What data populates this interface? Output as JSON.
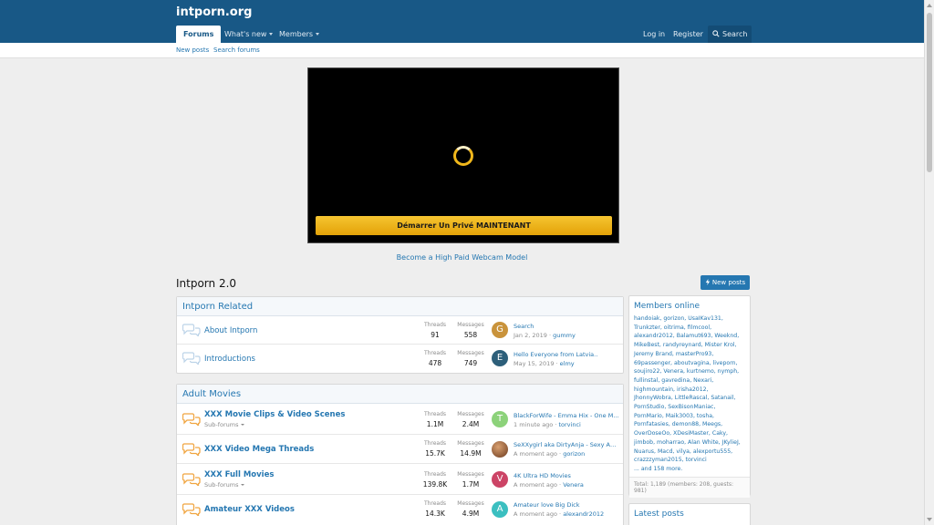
{
  "header": {
    "logo": "intporn.org",
    "tabs": [
      {
        "label": "Forums"
      },
      {
        "label": "What's new"
      },
      {
        "label": "Members"
      }
    ],
    "login": "Log in",
    "register": "Register",
    "search": "Search"
  },
  "subnav": {
    "new_posts": "New posts",
    "search_forums": "Search forums"
  },
  "ad": {
    "cta": "Démarrer Un Privé MAINTENANT",
    "link": "Become a High Paid Webcam Model"
  },
  "page": {
    "title": "Intporn 2.0",
    "new_posts_btn": "New posts"
  },
  "labels": {
    "threads": "Threads",
    "messages": "Messages",
    "subforums": "Sub-forums"
  },
  "categories": [
    {
      "title": "Intporn Related",
      "nodes": [
        {
          "title": "About Intporn",
          "threads": "91",
          "messages": "558",
          "avatar_letter": "G",
          "avatar_color": "#c9933b",
          "last_title": "Search",
          "last_date": "Jan 2, 2019",
          "last_user": "gummy"
        },
        {
          "title": "Introductions",
          "threads": "478",
          "messages": "749",
          "avatar_letter": "E",
          "avatar_color": "#2d5f7a",
          "last_title": "Hello Everyone from Latvia..",
          "last_date": "May 15, 2019",
          "last_user": "elmy"
        }
      ]
    },
    {
      "title": "Adult Movies",
      "nodes": [
        {
          "title": "XXX Movie Clips & Video Scenes",
          "subforums": true,
          "threads": "1.1M",
          "messages": "2.4M",
          "avatar_letter": "T",
          "avatar_color": "#8cd27a",
          "last_title": "BlackForWife - Emma Hix - One M...",
          "last_date": "1 minute ago",
          "last_user": "torvinci"
        },
        {
          "title": "XXX Video Mega Threads",
          "subforums": false,
          "threads": "15.7K",
          "messages": "14.9M",
          "avatar_letter": "",
          "avatar_color": "#7a4a2a",
          "last_title": "SeXXygirl aka DirtyAnja - Sexy Ama...",
          "last_date": "A moment ago",
          "last_user": "gorizon"
        },
        {
          "title": "XXX Full Movies",
          "subforums": true,
          "threads": "139.8K",
          "messages": "1.7M",
          "avatar_letter": "V",
          "avatar_color": "#cc4466",
          "last_title": "4K Ultra HD Movies",
          "last_date": "A moment ago",
          "last_user": "Venera"
        },
        {
          "title": "Amateur XXX Videos",
          "subforums": false,
          "threads": "14.3K",
          "messages": "4.9M",
          "avatar_letter": "A",
          "avatar_color": "#3bbfc0",
          "last_title": "Amateur love Big Dick",
          "last_date": "A moment ago",
          "last_user": "alexandr2012"
        }
      ]
    }
  ],
  "sidebar": {
    "members_online_title": "Members online",
    "members_text": "handoiak, gorizon, UsaIKav131, Trunkzter, oitrima, filmcool, alexandr2012, Balamut693, Weeknd, MikeBest, randyreynard, Mister Krol, Jeremy Brand, masterPro93, 69passenger, aboutvagina, liveporn, soujiro22, Venera, kurtnemo, nymph, fullinstal, gavredina, Nexari, highmountain, irisha2012, JhonnyWobra, LittleRascal, Satanail, PornStudio, SexBisonManiac, PornMario, Maik3003, tosha, Pornfatasies, demon88, Meegs, OverDoseOo, XDesiMaster, Caky, jimbob, moharrao, Alan White, JKylieJ, Nuarus, Macd, vilya, alexportu555, crazzzyman2015, torvinci",
    "members_more": "... and 158 more.",
    "total": "Total: 1,189 (members: 208, guests: 981)",
    "latest_posts_title": "Latest posts"
  }
}
